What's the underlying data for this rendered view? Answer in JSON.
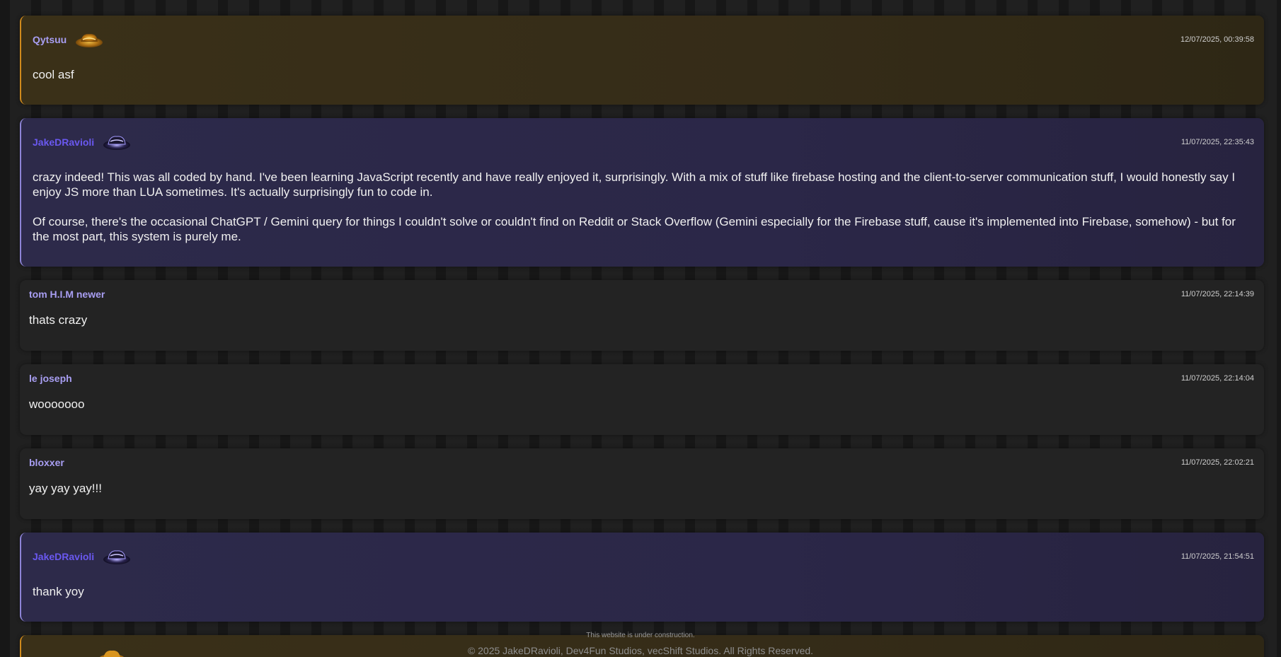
{
  "messages": [
    {
      "style": "gold",
      "username": "Qytsuu",
      "badge_icon": "gold-hat-icon",
      "timestamp": "12/07/2025, 00:39:58",
      "paragraphs": [
        "cool asf"
      ]
    },
    {
      "style": "purple",
      "username": "JakeDRavioli",
      "badge_icon": "purple-hat-icon",
      "timestamp": "11/07/2025, 22:35:43",
      "paragraphs": [
        "crazy indeed! This was all coded by hand. I've been learning JavaScript recently and have really enjoyed it, surprisingly. With a mix of stuff like firebase hosting and the client-to-server communication stuff, I would honestly say I enjoy JS more than LUA sometimes. It's actually surprisingly fun to code in.",
        "Of course, there's the occasional ChatGPT / Gemini query for things I couldn't solve or couldn't find on Reddit or Stack Overflow (Gemini especially for the Firebase stuff, cause it's implemented into Firebase, somehow) - but for the most part, this system is purely me."
      ]
    },
    {
      "style": "plain",
      "username": "tom H.I.M newer",
      "timestamp": "11/07/2025, 22:14:39",
      "paragraphs": [
        "thats crazy"
      ]
    },
    {
      "style": "plain",
      "username": "le joseph",
      "timestamp": "11/07/2025, 22:14:04",
      "paragraphs": [
        "wooooooo"
      ]
    },
    {
      "style": "plain",
      "username": "bloxxer",
      "timestamp": "11/07/2025, 22:02:21",
      "paragraphs": [
        "yay yay yay!!!"
      ]
    },
    {
      "style": "purple",
      "username": "JakeDRavioli",
      "badge_icon": "purple-hat-icon",
      "timestamp": "11/07/2025, 21:54:51",
      "paragraphs": [
        "thank yoy"
      ]
    }
  ],
  "colors": {
    "gold_accent": "#d08a1c",
    "purple_accent": "#8d84d6",
    "username": "#a89ef2",
    "admin_username": "#6a58f0"
  },
  "footer": {
    "note": "This website is under construction.",
    "copyright": "© 2025 JakeDRavioli, Dev4Fun Studios, vecShift Studios. All Rights Reserved."
  }
}
